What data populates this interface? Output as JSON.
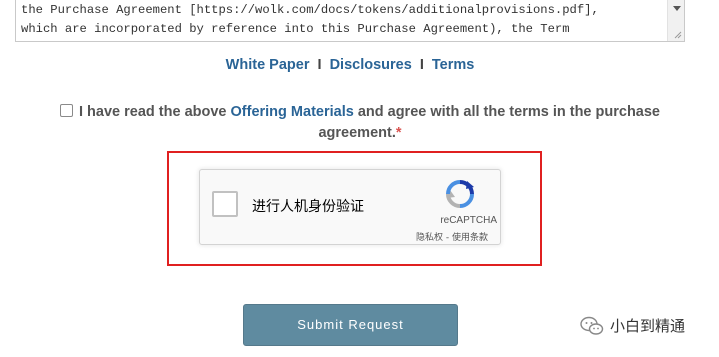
{
  "terms": {
    "line1": "the Purchase Agreement [https://wolk.com/docs/tokens/additionalprovisions.pdf],",
    "line2": "which are incorporated by reference into this Purchase Agreement), the Term"
  },
  "links": {
    "white_paper": "White Paper",
    "separator": "I",
    "disclosures": "Disclosures",
    "terms": "Terms"
  },
  "agreement": {
    "text_before": "I have read the above ",
    "link": "Offering Materials",
    "text_after": " and agree with all the terms in the purchase agreement.",
    "required_mark": "*",
    "checked": false
  },
  "captcha": {
    "label": "进行人机身份验证",
    "brand": "reCAPTCHA",
    "privacy_terms": "隐私权 - 使用条款"
  },
  "submit": {
    "label": "Submit Request"
  },
  "watermark": {
    "text": "小白到精通"
  },
  "colors": {
    "link": "#2a6496",
    "highlight": "#e02020",
    "submit_bg": "#5f8ba0",
    "required": "#d9534f"
  }
}
